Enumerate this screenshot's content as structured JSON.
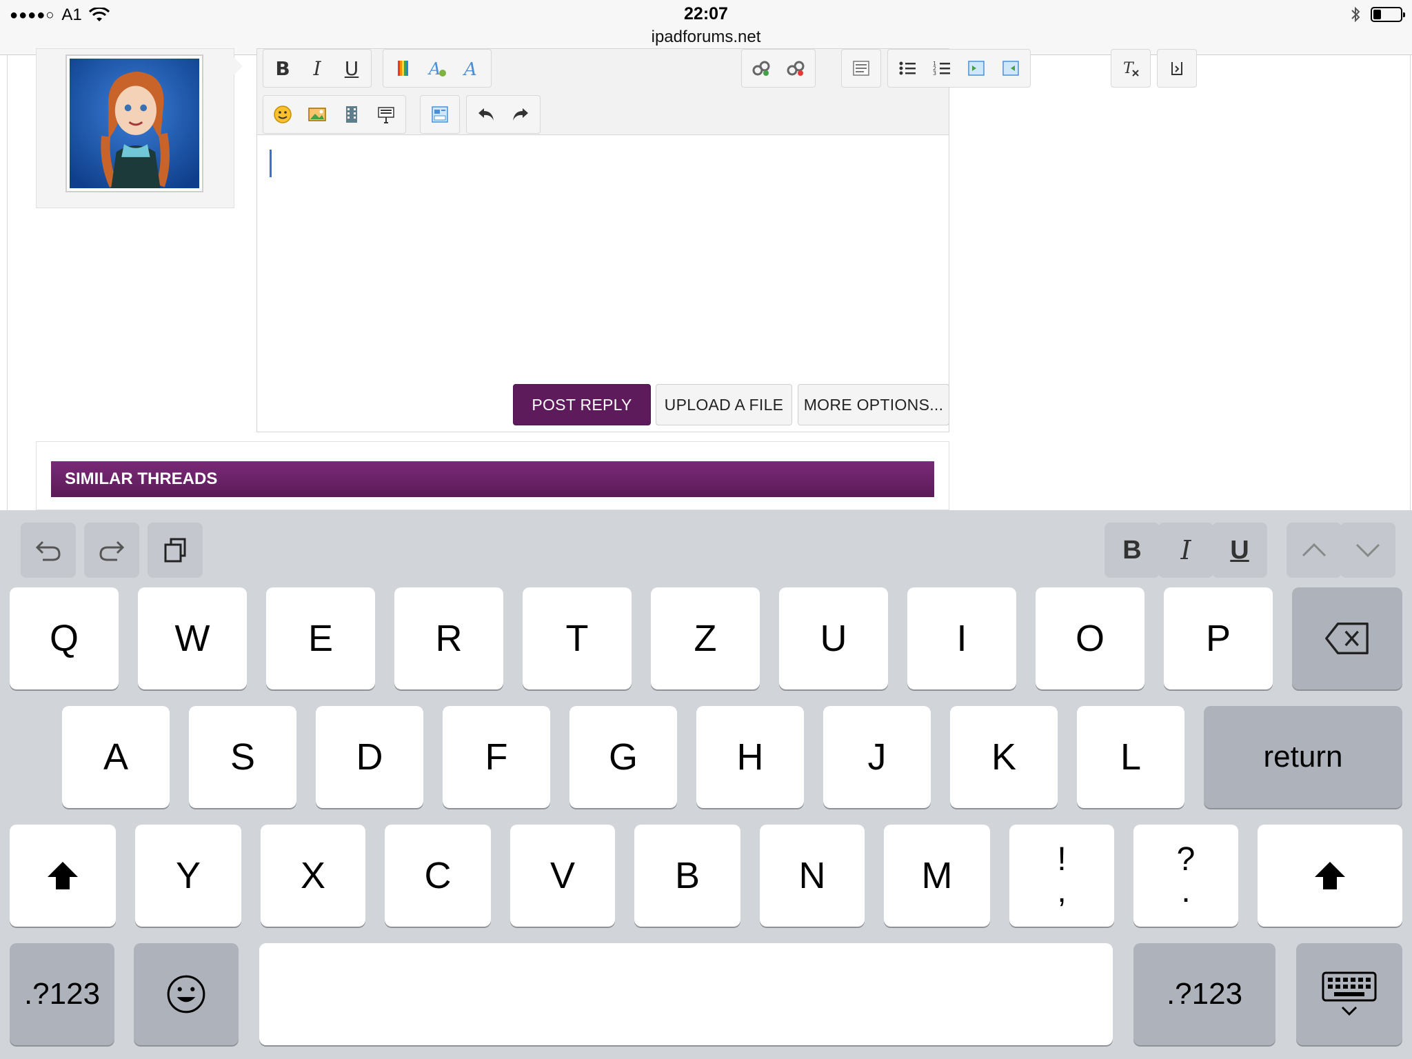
{
  "status_bar": {
    "carrier": "A1",
    "signal_dots": "●●●●○",
    "time": "22:07",
    "url": "ipadforums.net",
    "battery_level": 0.3
  },
  "editor": {
    "toolbar_icons": [
      "bold-icon",
      "italic-icon",
      "underline-icon",
      "text-color-icon",
      "font-family-icon",
      "font-size-icon",
      "link-icon",
      "unlink-icon",
      "align-icon",
      "bullet-list-icon",
      "numbered-list-icon",
      "indent-icon",
      "outdent-icon",
      "remove-format-icon",
      "source-code-icon",
      "smiley-icon",
      "image-icon",
      "media-icon",
      "code-block-icon",
      "template-icon",
      "undo-icon",
      "redo-icon"
    ]
  },
  "buttons": {
    "post_reply": "POST REPLY",
    "upload_file": "UPLOAD A FILE",
    "more_options": "MORE OPTIONS..."
  },
  "similar_threads": {
    "header": "SIMILAR THREADS"
  },
  "colors": {
    "accent": "#5e1b5c",
    "keyboard_bg": "#d1d4d9"
  },
  "keyboard": {
    "shortcut_bar": {
      "bold": "B",
      "italic": "I",
      "underline": "U"
    },
    "row1": [
      "Q",
      "W",
      "E",
      "R",
      "T",
      "Z",
      "U",
      "I",
      "O",
      "P"
    ],
    "row2": [
      "A",
      "S",
      "D",
      "F",
      "G",
      "H",
      "J",
      "K",
      "L"
    ],
    "row3": [
      "Y",
      "X",
      "C",
      "V",
      "B",
      "N",
      "M"
    ],
    "punct1_top": "!",
    "punct1_bottom": ",",
    "punct2_top": "?",
    "punct2_bottom": ".",
    "return": "return",
    "numbers_left": ".?123",
    "numbers_right": ".?123"
  }
}
